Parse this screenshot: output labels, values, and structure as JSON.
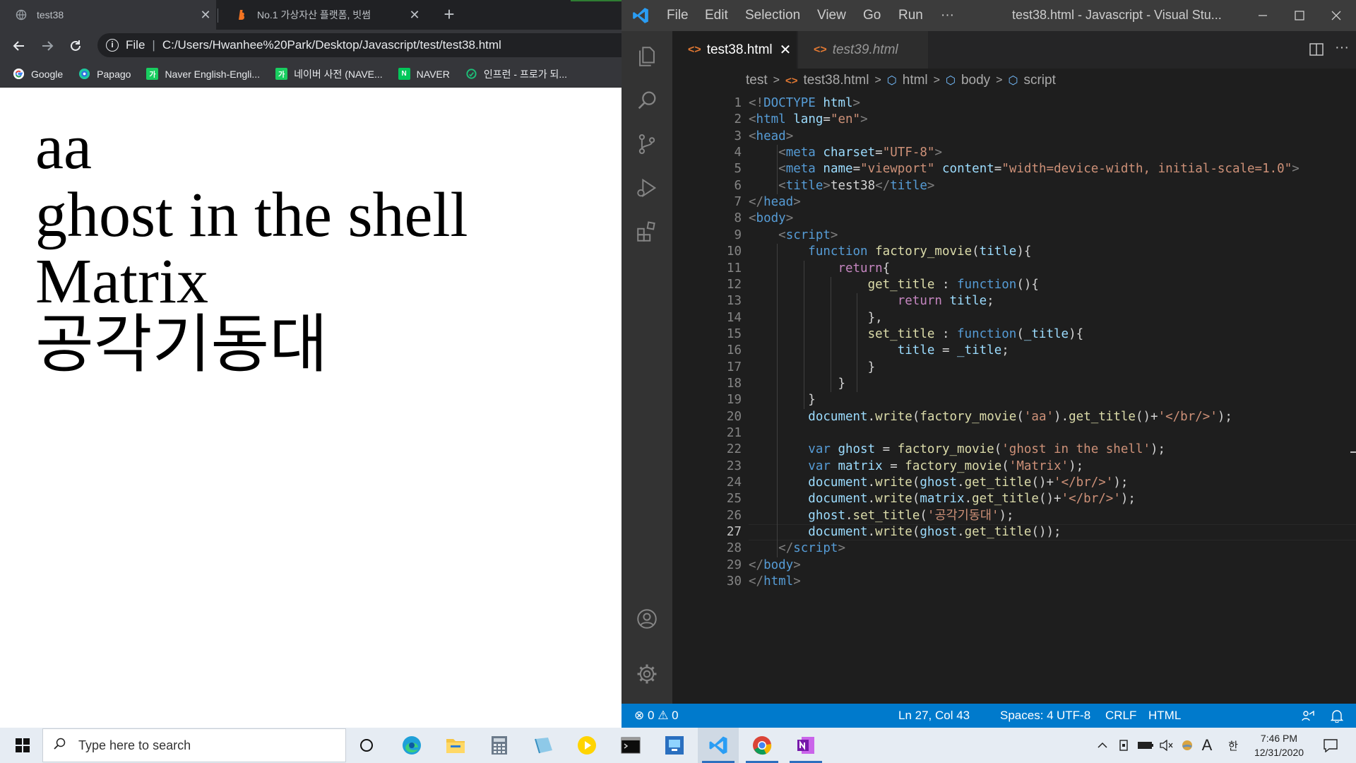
{
  "browser": {
    "tabs": [
      {
        "title": "test38",
        "active": true
      },
      {
        "title": "No.1 가상자산 플랫폼, 빗썸",
        "active": false
      }
    ],
    "address": {
      "scheme_label": "File",
      "url": "C:/Users/Hwanhee%20Park/Desktop/Javascript/test/test38.html"
    },
    "bookmarks": [
      {
        "label": "Google",
        "icon": "google-icon"
      },
      {
        "label": "Papago",
        "icon": "papago-icon"
      },
      {
        "label": "Naver English-Engli...",
        "icon": "naver-dict-icon"
      },
      {
        "label": "네이버 사전 (NAVE...",
        "icon": "naver-dict-icon"
      },
      {
        "label": "NAVER",
        "icon": "naver-icon"
      },
      {
        "label": "인프런 - 프로가 되...",
        "icon": "inflearn-icon"
      }
    ],
    "page_output": [
      "aa",
      "ghost in the shell",
      "Matrix",
      "공각기동대"
    ]
  },
  "vscode": {
    "menu": [
      "File",
      "Edit",
      "Selection",
      "View",
      "Go",
      "Run",
      "···"
    ],
    "window_title": "test38.html - Javascript - Visual Stu...",
    "editor_tabs": [
      {
        "label": "test38.html",
        "active": true
      },
      {
        "label": "test39.html",
        "active": false
      }
    ],
    "breadcrumb": [
      "test",
      "test38.html",
      "html",
      "body",
      "script"
    ],
    "current_line": 27,
    "code_lines": [
      [
        [
          "<!",
          "punc"
        ],
        [
          "DOCTYPE",
          "tag"
        ],
        [
          " ",
          "txt"
        ],
        [
          "html",
          "attr"
        ],
        [
          ">",
          "punc"
        ]
      ],
      [
        [
          "<",
          "punc"
        ],
        [
          "html",
          "tag"
        ],
        [
          " ",
          "txt"
        ],
        [
          "lang",
          "attr"
        ],
        [
          "=",
          "txt"
        ],
        [
          "\"en\"",
          "str"
        ],
        [
          ">",
          "punc"
        ]
      ],
      [
        [
          "<",
          "punc"
        ],
        [
          "head",
          "tag"
        ],
        [
          ">",
          "punc"
        ]
      ],
      [
        [
          "    ",
          "txt"
        ],
        [
          "<",
          "punc"
        ],
        [
          "meta",
          "tag"
        ],
        [
          " ",
          "txt"
        ],
        [
          "charset",
          "attr"
        ],
        [
          "=",
          "txt"
        ],
        [
          "\"UTF-8\"",
          "str"
        ],
        [
          ">",
          "punc"
        ]
      ],
      [
        [
          "    ",
          "txt"
        ],
        [
          "<",
          "punc"
        ],
        [
          "meta",
          "tag"
        ],
        [
          " ",
          "txt"
        ],
        [
          "name",
          "attr"
        ],
        [
          "=",
          "txt"
        ],
        [
          "\"viewport\"",
          "str"
        ],
        [
          " ",
          "txt"
        ],
        [
          "content",
          "attr"
        ],
        [
          "=",
          "txt"
        ],
        [
          "\"width=device-width, initial-scale=1.0\"",
          "str"
        ],
        [
          ">",
          "punc"
        ]
      ],
      [
        [
          "    ",
          "txt"
        ],
        [
          "<",
          "punc"
        ],
        [
          "title",
          "tag"
        ],
        [
          ">",
          "punc"
        ],
        [
          "test38",
          "txt"
        ],
        [
          "</",
          "punc"
        ],
        [
          "title",
          "tag"
        ],
        [
          ">",
          "punc"
        ]
      ],
      [
        [
          "</",
          "punc"
        ],
        [
          "head",
          "tag"
        ],
        [
          ">",
          "punc"
        ]
      ],
      [
        [
          "<",
          "punc"
        ],
        [
          "body",
          "tag"
        ],
        [
          ">",
          "punc"
        ]
      ],
      [
        [
          "    ",
          "txt"
        ],
        [
          "<",
          "punc"
        ],
        [
          "script",
          "tag"
        ],
        [
          ">",
          "punc"
        ]
      ],
      [
        [
          "        ",
          "txt"
        ],
        [
          "function",
          "kw"
        ],
        [
          " ",
          "txt"
        ],
        [
          "factory_movie",
          "fn"
        ],
        [
          "(",
          "txt"
        ],
        [
          "title",
          "var"
        ],
        [
          "){",
          "txt"
        ]
      ],
      [
        [
          "            ",
          "txt"
        ],
        [
          "return",
          "ctrl"
        ],
        [
          "{",
          "txt"
        ]
      ],
      [
        [
          "                ",
          "txt"
        ],
        [
          "get_title",
          "fn"
        ],
        [
          " : ",
          "txt"
        ],
        [
          "function",
          "kw"
        ],
        [
          "(){",
          "txt"
        ]
      ],
      [
        [
          "                    ",
          "txt"
        ],
        [
          "return",
          "ctrl"
        ],
        [
          " ",
          "txt"
        ],
        [
          "title",
          "var"
        ],
        [
          ";",
          "txt"
        ]
      ],
      [
        [
          "                ",
          "txt"
        ],
        [
          "},",
          "txt"
        ]
      ],
      [
        [
          "                ",
          "txt"
        ],
        [
          "set_title",
          "fn"
        ],
        [
          " : ",
          "txt"
        ],
        [
          "function",
          "kw"
        ],
        [
          "(",
          "txt"
        ],
        [
          "_title",
          "var"
        ],
        [
          "){",
          "txt"
        ]
      ],
      [
        [
          "                    ",
          "txt"
        ],
        [
          "title",
          "var"
        ],
        [
          " = ",
          "txt"
        ],
        [
          "_title",
          "var"
        ],
        [
          ";",
          "txt"
        ]
      ],
      [
        [
          "                ",
          "txt"
        ],
        [
          "}",
          "txt"
        ]
      ],
      [
        [
          "            ",
          "txt"
        ],
        [
          "}",
          "txt"
        ]
      ],
      [
        [
          "        ",
          "txt"
        ],
        [
          "}",
          "txt"
        ]
      ],
      [
        [
          "        ",
          "txt"
        ],
        [
          "document",
          "var"
        ],
        [
          ".",
          "txt"
        ],
        [
          "write",
          "fn"
        ],
        [
          "(",
          "txt"
        ],
        [
          "factory_movie",
          "fn"
        ],
        [
          "(",
          "txt"
        ],
        [
          "'aa'",
          "str"
        ],
        [
          ").",
          "txt"
        ],
        [
          "get_title",
          "fn"
        ],
        [
          "()+",
          "txt"
        ],
        [
          "'</br/>'",
          "str"
        ],
        [
          ");",
          "txt"
        ]
      ],
      [
        [
          "",
          "txt"
        ]
      ],
      [
        [
          "        ",
          "txt"
        ],
        [
          "var",
          "kw"
        ],
        [
          " ",
          "txt"
        ],
        [
          "ghost",
          "var"
        ],
        [
          " = ",
          "txt"
        ],
        [
          "factory_movie",
          "fn"
        ],
        [
          "(",
          "txt"
        ],
        [
          "'ghost in the shell'",
          "str"
        ],
        [
          ");",
          "txt"
        ]
      ],
      [
        [
          "        ",
          "txt"
        ],
        [
          "var",
          "kw"
        ],
        [
          " ",
          "txt"
        ],
        [
          "matrix",
          "var"
        ],
        [
          " = ",
          "txt"
        ],
        [
          "factory_movie",
          "fn"
        ],
        [
          "(",
          "txt"
        ],
        [
          "'Matrix'",
          "str"
        ],
        [
          ");",
          "txt"
        ]
      ],
      [
        [
          "        ",
          "txt"
        ],
        [
          "document",
          "var"
        ],
        [
          ".",
          "txt"
        ],
        [
          "write",
          "fn"
        ],
        [
          "(",
          "txt"
        ],
        [
          "ghost",
          "var"
        ],
        [
          ".",
          "txt"
        ],
        [
          "get_title",
          "fn"
        ],
        [
          "()+",
          "txt"
        ],
        [
          "'</br/>'",
          "str"
        ],
        [
          ");",
          "txt"
        ]
      ],
      [
        [
          "        ",
          "txt"
        ],
        [
          "document",
          "var"
        ],
        [
          ".",
          "txt"
        ],
        [
          "write",
          "fn"
        ],
        [
          "(",
          "txt"
        ],
        [
          "matrix",
          "var"
        ],
        [
          ".",
          "txt"
        ],
        [
          "get_title",
          "fn"
        ],
        [
          "()+",
          "txt"
        ],
        [
          "'</br/>'",
          "str"
        ],
        [
          ");",
          "txt"
        ]
      ],
      [
        [
          "        ",
          "txt"
        ],
        [
          "ghost",
          "var"
        ],
        [
          ".",
          "txt"
        ],
        [
          "set_title",
          "fn"
        ],
        [
          "(",
          "txt"
        ],
        [
          "'공각기동대'",
          "str"
        ],
        [
          ");",
          "txt"
        ]
      ],
      [
        [
          "        ",
          "txt"
        ],
        [
          "document",
          "var"
        ],
        [
          ".",
          "txt"
        ],
        [
          "write",
          "fn"
        ],
        [
          "(",
          "txt"
        ],
        [
          "ghost",
          "var"
        ],
        [
          ".",
          "txt"
        ],
        [
          "get_title",
          "fn"
        ],
        [
          "());",
          "txt"
        ]
      ],
      [
        [
          "    ",
          "txt"
        ],
        [
          "</",
          "punc"
        ],
        [
          "script",
          "tag"
        ],
        [
          ">",
          "punc"
        ]
      ],
      [
        [
          "</",
          "punc"
        ],
        [
          "body",
          "tag"
        ],
        [
          ">",
          "punc"
        ]
      ],
      [
        [
          "</",
          "punc"
        ],
        [
          "html",
          "tag"
        ],
        [
          ">",
          "punc"
        ]
      ]
    ],
    "status": {
      "errors": "0",
      "warnings": "0",
      "position": "Ln 27, Col 43",
      "spaces": "Spaces: 4",
      "encoding": "UTF-8",
      "eol": "CRLF",
      "language": "HTML"
    },
    "colors": {
      "statusbar": "#007acc",
      "titlebar": "#3c3c3c",
      "editor": "#1e1e1e"
    }
  },
  "taskbar": {
    "search_placeholder": "Type here to search",
    "apps": [
      "task-view",
      "edge",
      "file-explorer",
      "calculator",
      "notepad-like",
      "media-player",
      "terminal",
      "remote-desktop",
      "vscode",
      "chrome",
      "onenote"
    ],
    "ime": "A",
    "ime_korean": "한",
    "time": "7:46 PM",
    "date": "12/31/2020"
  }
}
